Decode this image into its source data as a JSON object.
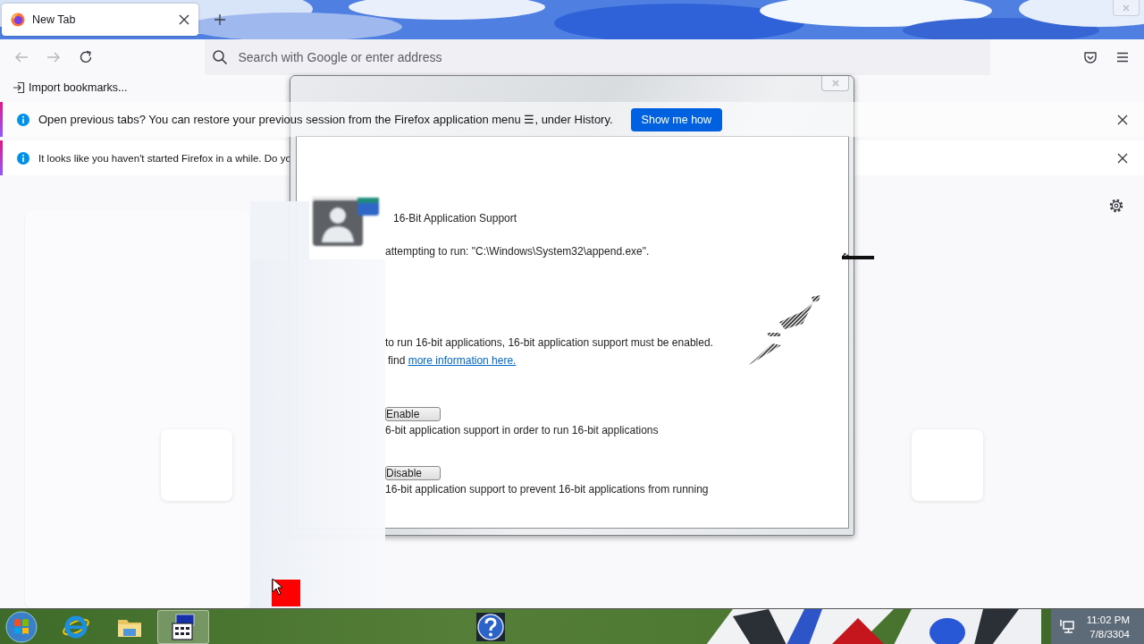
{
  "browser": {
    "tabs": [
      {
        "title": "New Tab",
        "selected": true
      }
    ],
    "address_bar": {
      "placeholder": "Search with Google or enter address"
    },
    "bookmarks": [
      "Import bookmarks..."
    ],
    "notifications": [
      {
        "text": "Open previous tabs? You can restore your previous session from the Firefox application menu ☰, under History.",
        "button": "Show me how"
      },
      {
        "text": "It looks like you haven't started Firefox in a while. Do yo"
      }
    ]
  },
  "dialog": {
    "title": "16-Bit Application Support",
    "message": "attempting to run: \"C:\\Windows\\System32\\append.exe\".",
    "info": "to run 16-bit applications, 16-bit application support must be enabled.",
    "info_link_prefix": "find",
    "info_link": "more information here.",
    "options": [
      {
        "button": "Enable",
        "description": "6-bit application support in order to run 16-bit applications"
      },
      {
        "button": "Disable",
        "description": "16-bit application support to prevent 16-bit applications from running"
      }
    ]
  },
  "taskbar": {
    "apps": [
      {
        "kind": "browser",
        "selected": false
      },
      {
        "kind": "folder",
        "selected": false
      },
      {
        "kind": "console",
        "selected": true
      },
      {
        "kind": "help",
        "selected": false
      }
    ],
    "clock": {
      "time": "11:02 PM",
      "date": "7/8/3304"
    }
  }
}
